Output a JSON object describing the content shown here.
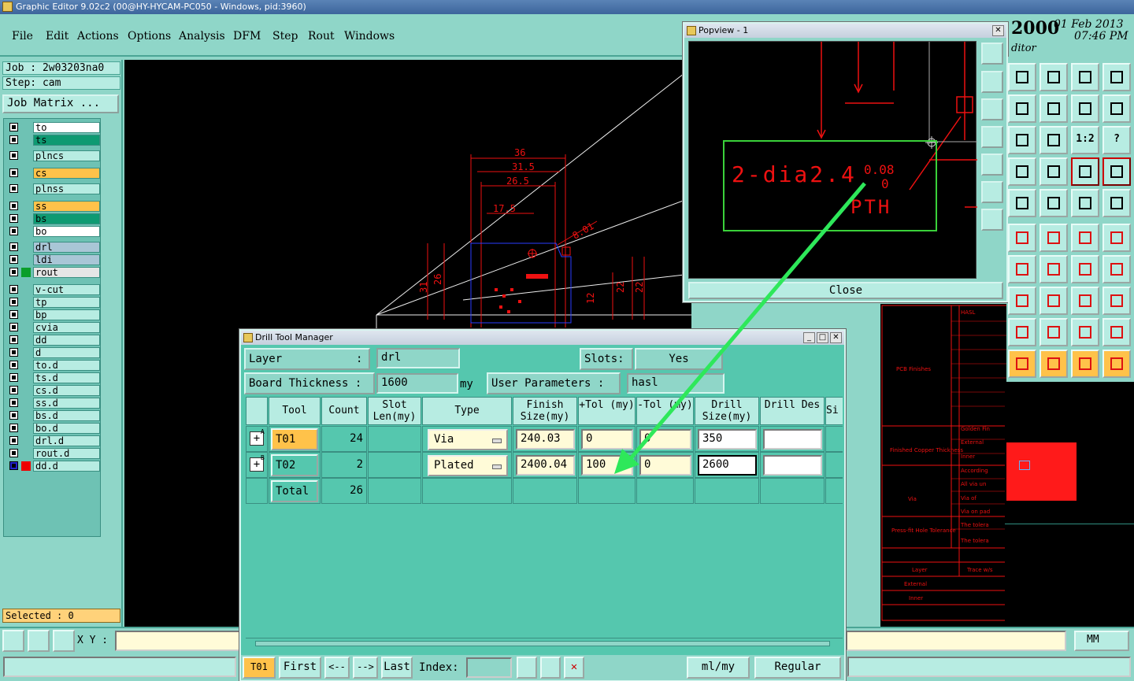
{
  "window": {
    "title": "Graphic Editor 9.02c2 (00@HY-HYCAM-PC050 - Windows, pid:3960)"
  },
  "menu": [
    "File",
    "Edit",
    "Actions",
    "Options",
    "Analysis",
    "DFM",
    "Step",
    "Rout",
    "Windows"
  ],
  "clock": {
    "year": "2000",
    "date": "01 Feb 2013",
    "time": "07:46 PM",
    "editor_label": "ditor"
  },
  "job": {
    "job_label": "Job : 2w03203na0",
    "step_label": "Step: cam",
    "matrix_button": "Job Matrix ..."
  },
  "layers": [
    {
      "name": "to",
      "color": "#ffffff"
    },
    {
      "name": "ts",
      "color": "#0e9a72"
    },
    {
      "name": "plncs",
      "color": "#b7ece2"
    },
    {
      "name": "cs",
      "color": "#ffc24a"
    },
    {
      "name": "plnss",
      "color": "#b7ece2"
    },
    {
      "name": "ss",
      "color": "#ffc24a"
    },
    {
      "name": "bs",
      "color": "#0e9a72"
    },
    {
      "name": "bo",
      "color": "#ffffff"
    },
    {
      "name": "drl",
      "color": "#a9c6d6"
    },
    {
      "name": "ldi",
      "color": "#a9c6d6"
    },
    {
      "name": "rout",
      "color": "#e6e6e6"
    },
    {
      "name": "v-cut",
      "color": "#b7ece2"
    },
    {
      "name": "tp",
      "color": "#b7ece2"
    },
    {
      "name": "bp",
      "color": "#b7ece2"
    },
    {
      "name": "cvia",
      "color": "#b7ece2"
    },
    {
      "name": "dd",
      "color": "#b7ece2"
    },
    {
      "name": "d",
      "color": "#b7ece2"
    },
    {
      "name": "to.d",
      "color": "#b7ece2"
    },
    {
      "name": "ts.d",
      "color": "#b7ece2"
    },
    {
      "name": "cs.d",
      "color": "#b7ece2"
    },
    {
      "name": "ss.d",
      "color": "#b7ece2"
    },
    {
      "name": "bs.d",
      "color": "#b7ece2"
    },
    {
      "name": "bo.d",
      "color": "#b7ece2"
    },
    {
      "name": "drl.d",
      "color": "#b7ece2"
    },
    {
      "name": "rout.d",
      "color": "#b7ece2"
    },
    {
      "name": "dd.d",
      "color": "#b7ece2"
    }
  ],
  "selected": "Selected : 0",
  "xy": {
    "label": "X Y :",
    "value": ""
  },
  "units": "MM",
  "canvas": {
    "dims": [
      "36",
      "31.5",
      "26.5",
      "17.5",
      "8.01",
      "31",
      "26",
      "22",
      "22",
      "12"
    ]
  },
  "popview": {
    "title": "Popview - 1",
    "close_label": "Close",
    "annotation_main": "2-dia2.4",
    "annotation_tol_top": "0.08",
    "annotation_tol_bottom": "0",
    "annotation_sub": "PTH"
  },
  "schematic": {
    "labels": [
      "HASL",
      "PCB Finishes",
      "Golden Fin",
      "External",
      "Inner",
      "Finished Copper Thickness",
      "According",
      "All via un",
      "Via",
      "Via of",
      "Via on pad",
      "Press-fit Hole Tolerance",
      "The tolera",
      "The tolera",
      "Layer",
      "Trace w/s",
      "External",
      "Inner"
    ]
  },
  "dtm": {
    "title": "Drill Tool Manager",
    "layer_label": "Layer",
    "layer_colon": ":",
    "layer_value": "drl",
    "slots_label": "Slots:",
    "slots_value": "Yes",
    "thickness_label": "Board Thickness :",
    "thickness_value": "1600",
    "thickness_unit": "my",
    "user_params_label": "User Parameters :",
    "user_params_value": "hasl",
    "columns": [
      "Tool",
      "Count",
      "Slot Len(my)",
      "Type",
      "Finish Size(my)",
      "+Tol (my)",
      "-Tol (my)",
      "Drill Size(my)",
      "Drill Des",
      "Si"
    ],
    "rows": [
      {
        "tool": "T01",
        "count": "24",
        "slot": "",
        "type": "Via",
        "finish": "240.03",
        "ptol": "0",
        "ntol": "0",
        "drill": "350",
        "des": "",
        "expander": "+",
        "expander_sup": "A"
      },
      {
        "tool": "T02",
        "count": "2",
        "slot": "",
        "type": "Plated",
        "finish": "2400.04",
        "ptol": "100",
        "ntol": "0",
        "drill": "2600",
        "des": "",
        "expander": "+",
        "expander_sup": "B"
      }
    ],
    "total_label": "Total",
    "total_count": "26",
    "bottom": {
      "current": "T01",
      "first": "First",
      "prev": "<--",
      "next": "-->",
      "last": "Last",
      "index_label": "Index:",
      "index_value": "",
      "units": "ml/my",
      "mode": "Regular"
    }
  }
}
